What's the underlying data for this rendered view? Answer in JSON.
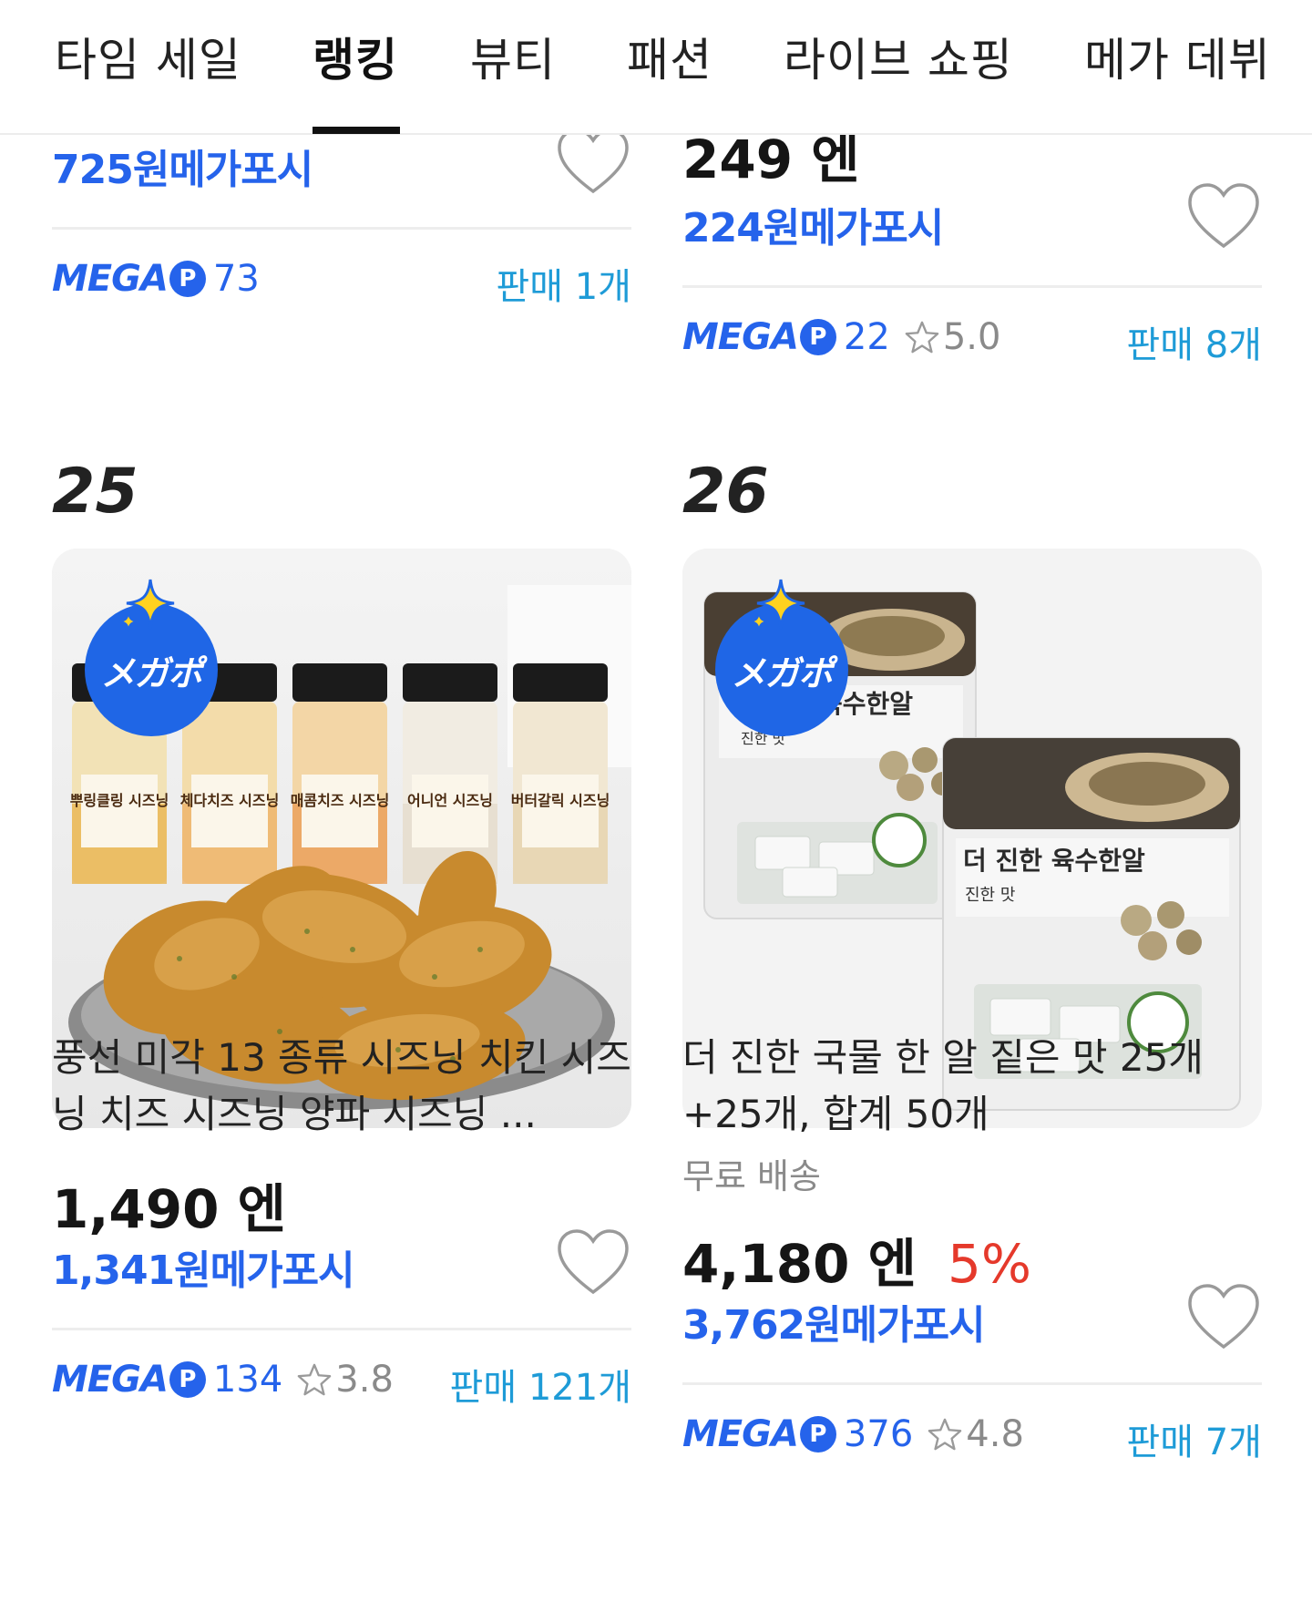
{
  "nav": {
    "tabs": [
      {
        "label": "타임 세일"
      },
      {
        "label": "랭킹"
      },
      {
        "label": "뷰티"
      },
      {
        "label": "패션"
      },
      {
        "label": "라이브 쇼핑"
      },
      {
        "label": "메가 데뷔"
      }
    ],
    "active_tab": "랭킹"
  },
  "prev_cards": [
    {
      "mega_price": "725원메가포시",
      "mega_logo": "MEGA",
      "mega_points": "73",
      "sold": "판매 1개"
    },
    {
      "price": "249 엔",
      "mega_price": "224원메가포시",
      "mega_logo": "MEGA",
      "mega_points": "22",
      "rating": "5.0",
      "sold": "판매 8개"
    }
  ],
  "products": [
    {
      "rank": "25",
      "badge": "メガポ",
      "jar_labels": [
        "뿌링클링 시즈닝",
        "체다치즈 시즈닝",
        "매콤치즈 시즈닝",
        "어니언 시즈닝",
        "버터갈릭 시즈닝"
      ],
      "title": "풍선 미각 13 종류 시즈닝 치킨 시즈닝 치즈 시즈닝 양파 시즈닝 ...",
      "price": "1,490 엔",
      "mega_price": "1,341원메가포시",
      "mega_logo": "MEGA",
      "mega_points": "134",
      "rating": "3.8",
      "sold": "판매 121개"
    },
    {
      "rank": "26",
      "badge": "メガポ",
      "package_title": "더 진한 육수한알",
      "package_subtitle": "진한 맛",
      "package_front_title": "육수한알",
      "title": "더 진한 국물 한 알 짙은 맛 25개+25개, 합계 50개",
      "shipping": "무료 배송",
      "price": "4,180 엔",
      "discount": "5%",
      "mega_price": "3,762원메가포시",
      "mega_logo": "MEGA",
      "mega_points": "376",
      "rating": "4.8",
      "sold": "판매 7개"
    }
  ],
  "colors": {
    "mega_blue": "#2563eb",
    "sold_blue": "#1e9bd7",
    "discount_red": "#e5392b",
    "badge_blue": "#1f66e6",
    "badge_sparkle": "#ffd21f"
  }
}
